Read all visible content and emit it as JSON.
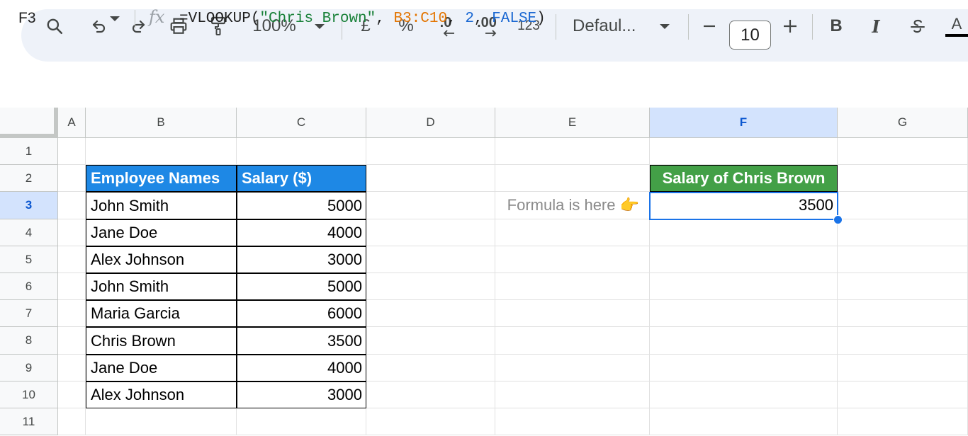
{
  "toolbar": {
    "zoom": "100%",
    "currency_symbol": "£",
    "percent_symbol": "%",
    "decrease_decimal": ".0",
    "increase_decimal": ".00",
    "number_format": "123",
    "font_name": "Defaul...",
    "font_size": "10",
    "bold_label": "B",
    "italic_label": "I",
    "text_color_label": "A",
    "icons": [
      "search-icon",
      "undo-icon",
      "redo-icon",
      "print-icon",
      "paint-format-icon",
      "chevron-down-icon",
      "minus-icon",
      "plus-icon",
      "strikethrough-icon",
      "text-color-icon"
    ]
  },
  "formula_bar": {
    "name_box": "F3",
    "fx_label": "fx",
    "formula_parts": [
      {
        "text": "=VLOOKUP(",
        "color": "#1f1f1f"
      },
      {
        "text": "\"Chris Brown\"",
        "color": "#188038"
      },
      {
        "text": ", ",
        "color": "#1f1f1f"
      },
      {
        "text": "B3:C10",
        "color": "#e37400"
      },
      {
        "text": ", ",
        "color": "#1f1f1f"
      },
      {
        "text": "2",
        "color": "#1967d2"
      },
      {
        "text": ", ",
        "color": "#1f1f1f"
      },
      {
        "text": "FALSE",
        "color": "#1967d2"
      },
      {
        "text": ")",
        "color": "#1f1f1f"
      }
    ]
  },
  "sheet": {
    "columns": [
      "A",
      "B",
      "C",
      "D",
      "E",
      "F",
      "G"
    ],
    "rows": [
      "1",
      "2",
      "3",
      "4",
      "5",
      "6",
      "7",
      "8",
      "9",
      "10",
      "11"
    ],
    "selected_cell": "F3",
    "table_header": {
      "name": "Employee Names",
      "salary": "Salary ($)"
    },
    "employees": [
      {
        "name": "John Smith",
        "salary": "5000"
      },
      {
        "name": "Jane Doe",
        "salary": "4000"
      },
      {
        "name": "Alex Johnson",
        "salary": "3000"
      },
      {
        "name": "John Smith",
        "salary": "5000"
      },
      {
        "name": "Maria Garcia",
        "salary": "6000"
      },
      {
        "name": "Chris Brown",
        "salary": "3500"
      },
      {
        "name": "Jane Doe",
        "salary": "4000"
      },
      {
        "name": "Alex Johnson",
        "salary": "3000"
      }
    ],
    "result_header": "Salary of Chris Brown",
    "result_value": "3500",
    "note": "Formula is here 👉",
    "colors": {
      "table_header_bg": "#1e88e5",
      "result_header_bg": "#43a047",
      "selection": "#1a73e8"
    }
  }
}
